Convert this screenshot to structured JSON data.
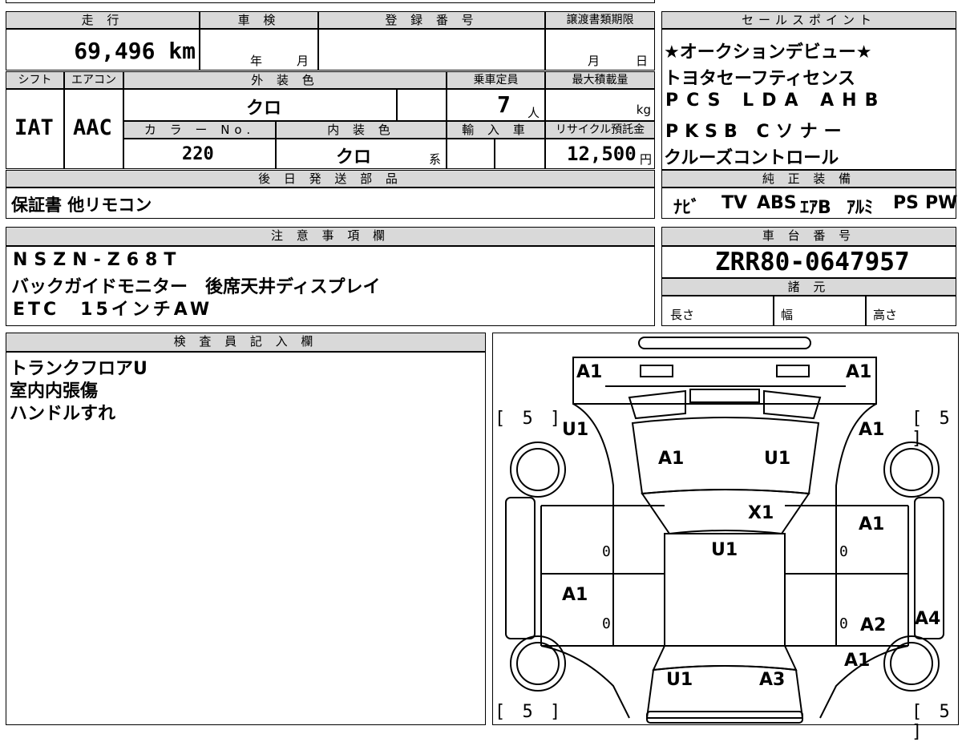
{
  "top": {
    "mileage_label": "走 行",
    "mileage_value": "69,496 km",
    "shaken_label": "車 検",
    "shaken_year": "年",
    "shaken_month": "月",
    "reg_label": "登 録 番 号",
    "transfer_label": "譲渡書類期限",
    "transfer_month": "月",
    "transfer_day": "日",
    "shift_label": "シフト",
    "shift_value": "IAT",
    "ac_label": "エアコン",
    "ac_value": "AAC",
    "exterior_label": "外 装 色",
    "exterior_value": "クロ",
    "capacity_label": "乗車定員",
    "capacity_value": "7",
    "capacity_unit": "人",
    "load_label": "最大積載量",
    "load_unit": "kg",
    "color_no_label": "カ ラ ー No.",
    "color_no_value": "220",
    "interior_label": "内 装 色",
    "interior_value": "クロ",
    "interior_suffix": "系",
    "import_label": "輸 入 車",
    "recycle_label": "リサイクル預託金",
    "recycle_value": "12,500",
    "recycle_unit": "円",
    "later_label": "後 日 発 送 部 品",
    "later_value": "保証書 他リモコン"
  },
  "sales": {
    "label": "セールスポイント",
    "lines": [
      "★オークションデビュー★",
      "トヨタセーフティセンス",
      "PCS LDA AHB",
      "PKSB Cソナー",
      "クルーズコントロール"
    ]
  },
  "equipment": {
    "label": "純 正 装 備",
    "items": [
      "ﾅﾋﾞ",
      "TV",
      "ABS",
      "ｴｱB",
      "ｱﾙﾐ",
      "PS",
      "PW"
    ]
  },
  "notes": {
    "label": "注 意 事 項 欄",
    "lines": [
      "NSZN-Z68T",
      "バックガイドモニター　後席天井ディスプレイ",
      "ETC　15インチAW"
    ]
  },
  "chassis": {
    "label": "車 台 番 号",
    "value": "ZRR80-0647957",
    "spec_label": "諸 元",
    "length": "長さ",
    "width": "幅",
    "height": "高さ"
  },
  "inspector": {
    "label": "検 査 員 記 入 欄",
    "lines": [
      "トランクフロアU",
      "室内内張傷",
      "ハンドルすれ"
    ]
  },
  "diagram": {
    "marks": {
      "front_left": "A1",
      "front_right": "A1",
      "fender_fl": "U1",
      "fender_fr": "A1",
      "hood_left": "A1",
      "hood_right": "U1",
      "windshield": "X1",
      "door_fr": "A1",
      "roof": "U1",
      "door_rl": "A1",
      "door_rr": "A2",
      "rear_fender_r": "A1",
      "side_r": "A4",
      "rear_left": "U1",
      "rear_right": "A3"
    },
    "tires": {
      "fl": "[ 5 ]",
      "fr": "[ 5 ]",
      "rl": "[ 5 ]",
      "rr": "[ 5 ]"
    },
    "zeros": [
      "0",
      "0",
      "0",
      "0"
    ]
  }
}
